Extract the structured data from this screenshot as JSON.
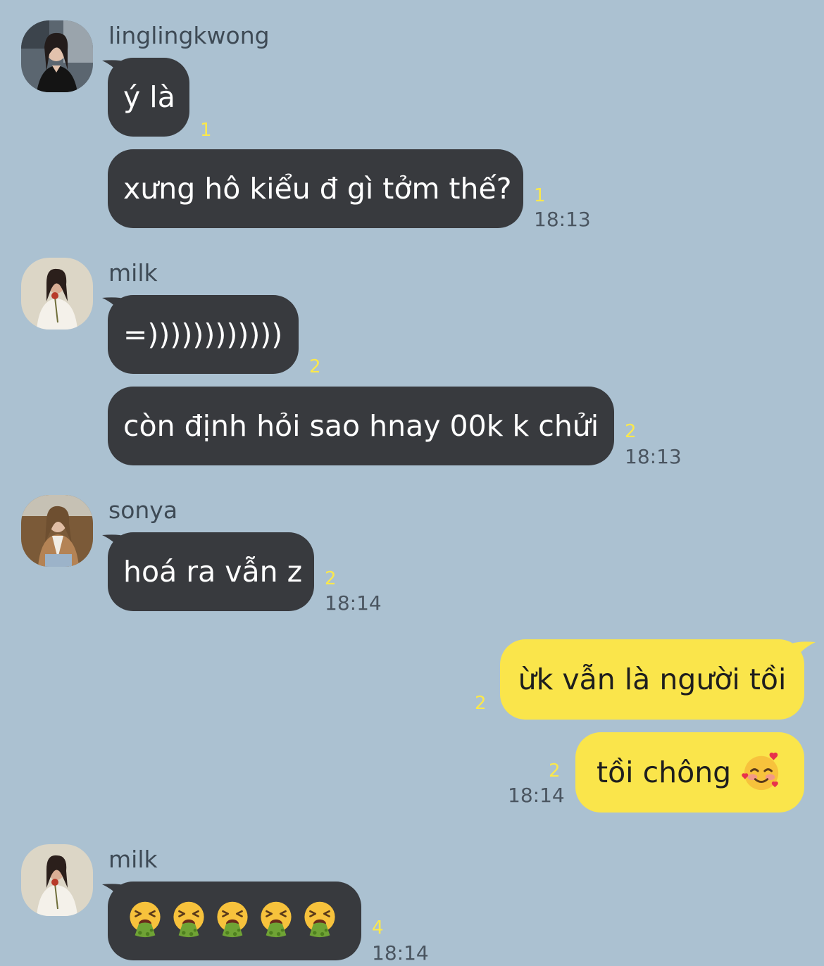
{
  "messages": [
    {
      "sender": "linglingkwong",
      "avatar": "linglingkwong-avatar",
      "bubbles": [
        {
          "text": "ý là",
          "unread": "1",
          "time": ""
        },
        {
          "text": "xưng hô kiểu đ gì tởm thế?",
          "unread": "1",
          "time": "18:13"
        }
      ]
    },
    {
      "sender": "milk",
      "avatar": "milk-avatar",
      "bubbles": [
        {
          "text": "=))))))))))))",
          "unread": "2",
          "time": ""
        },
        {
          "text": "còn định hỏi sao hnay 00k k chửi",
          "unread": "2",
          "time": "18:13"
        }
      ]
    },
    {
      "sender": "sonya",
      "avatar": "sonya-avatar",
      "bubbles": [
        {
          "text": "hoá ra vẫn z",
          "unread": "2",
          "time": "18:14"
        }
      ]
    },
    {
      "sender": "me",
      "bubbles": [
        {
          "text": "ừk vẫn là người tồi",
          "unread": "2",
          "time": ""
        },
        {
          "text": "tồi chông",
          "emoji": "smiling-face-with-hearts",
          "unread": "2",
          "time": "18:14"
        }
      ]
    },
    {
      "sender": "milk",
      "avatar": "milk-avatar",
      "bubbles": [
        {
          "emoji": "face-vomiting",
          "emoji_count": 5,
          "unread": "4",
          "time": "18:14"
        }
      ]
    }
  ],
  "colors": {
    "background": "#abc1d1",
    "incoming_bubble": "#383a3e",
    "outgoing_bubble": "#fae54b",
    "unread_count": "#fbe84b",
    "timestamp": "#4a5560"
  }
}
